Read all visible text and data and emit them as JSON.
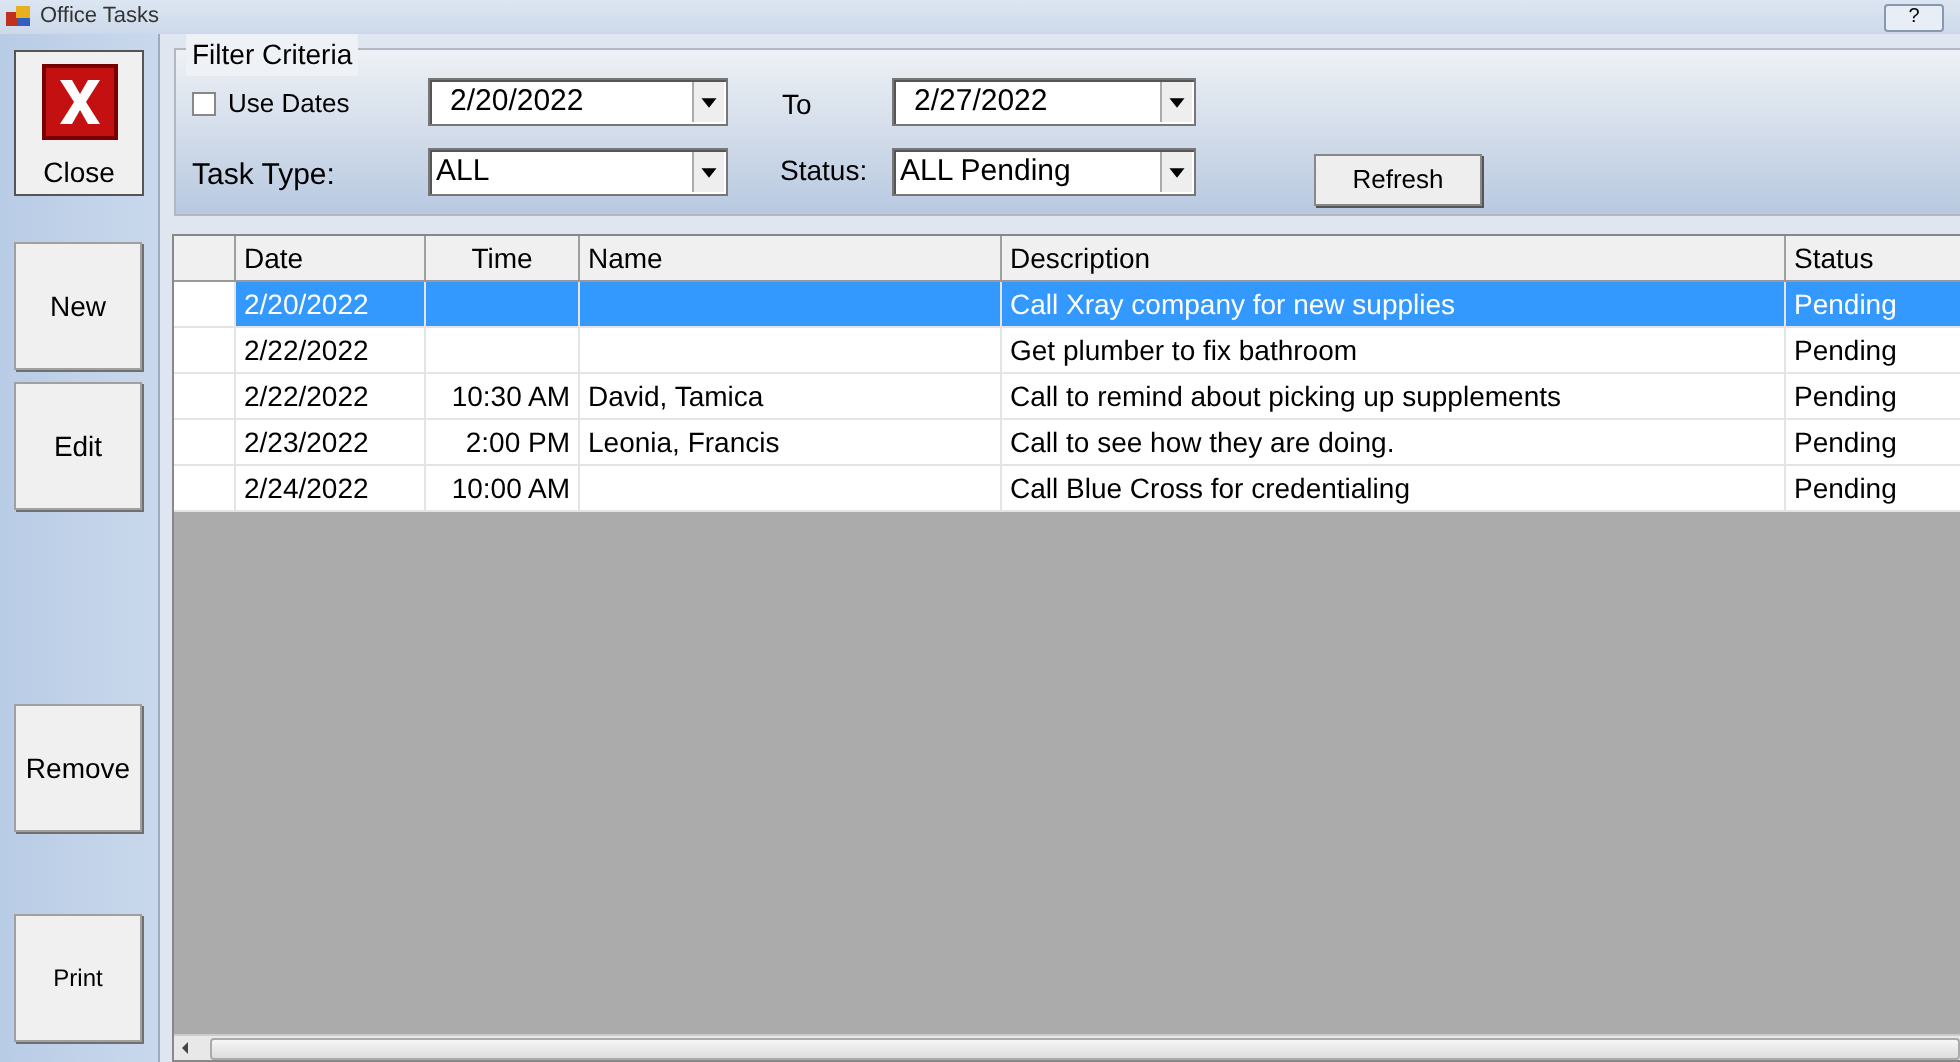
{
  "window": {
    "title": "Office Tasks",
    "help_button": "?"
  },
  "close_button": {
    "label": "Close"
  },
  "side_buttons": [
    {
      "label": "New"
    },
    {
      "label": "Edit"
    },
    {
      "label": "Remove"
    },
    {
      "label": "Print"
    }
  ],
  "filter": {
    "legend": "Filter Criteria",
    "use_dates": {
      "label": "Use Dates",
      "checked": false
    },
    "from_date": "2/20/2022",
    "to_label": "To",
    "to_date": "2/27/2022",
    "task_type_label": "Task Type:",
    "task_type": "ALL",
    "status_label": "Status:",
    "status": "ALL Pending",
    "refresh_button": "Refresh"
  },
  "table": {
    "columns": [
      "Date",
      "Time",
      "Name",
      "Description",
      "Status"
    ],
    "rows": [
      {
        "selected": true,
        "cells": [
          "2/20/2022",
          "",
          "",
          "Call Xray company for new supplies",
          "Pending"
        ]
      },
      {
        "selected": false,
        "cells": [
          "2/22/2022",
          "",
          "",
          "Get plumber to fix bathroom",
          "Pending"
        ]
      },
      {
        "selected": false,
        "cells": [
          "2/22/2022",
          "10:30 AM",
          "David, Tamica",
          "Call to remind about picking up supplements",
          "Pending"
        ]
      },
      {
        "selected": false,
        "cells": [
          "2/23/2022",
          "2:00 PM",
          "Leonia, Francis",
          "Call to see how they are doing.",
          "Pending"
        ]
      },
      {
        "selected": false,
        "cells": [
          "2/24/2022",
          "10:00 AM",
          "",
          "Call Blue Cross for credentialing",
          "Pending"
        ]
      }
    ]
  }
}
